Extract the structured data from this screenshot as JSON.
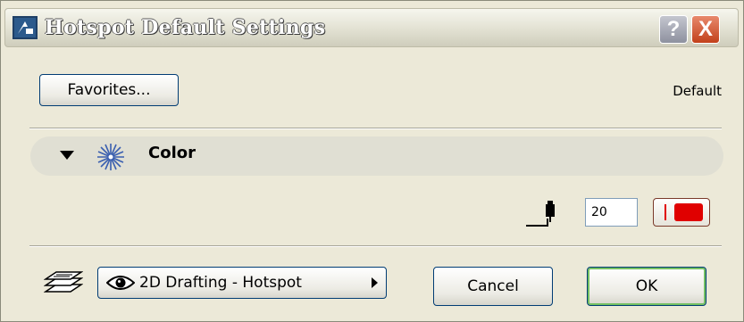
{
  "window": {
    "title": "Hotspot Default Settings",
    "help_label": "?",
    "close_label": "X",
    "app_icon": "archicad-app-icon"
  },
  "top": {
    "favorites_label": "Favorites...",
    "status_label": "Default"
  },
  "panel": {
    "title": "Color",
    "expanded": true,
    "icon": "hotspot-star-icon"
  },
  "pen": {
    "icon": "pen-icon",
    "number": "20",
    "color": "#e00000"
  },
  "bottom": {
    "layers_icon": "layers-icon",
    "layer_eye_icon": "eye-icon",
    "layer_label": "2D Drafting - Hotspot",
    "cancel_label": "Cancel",
    "ok_label": "OK"
  }
}
